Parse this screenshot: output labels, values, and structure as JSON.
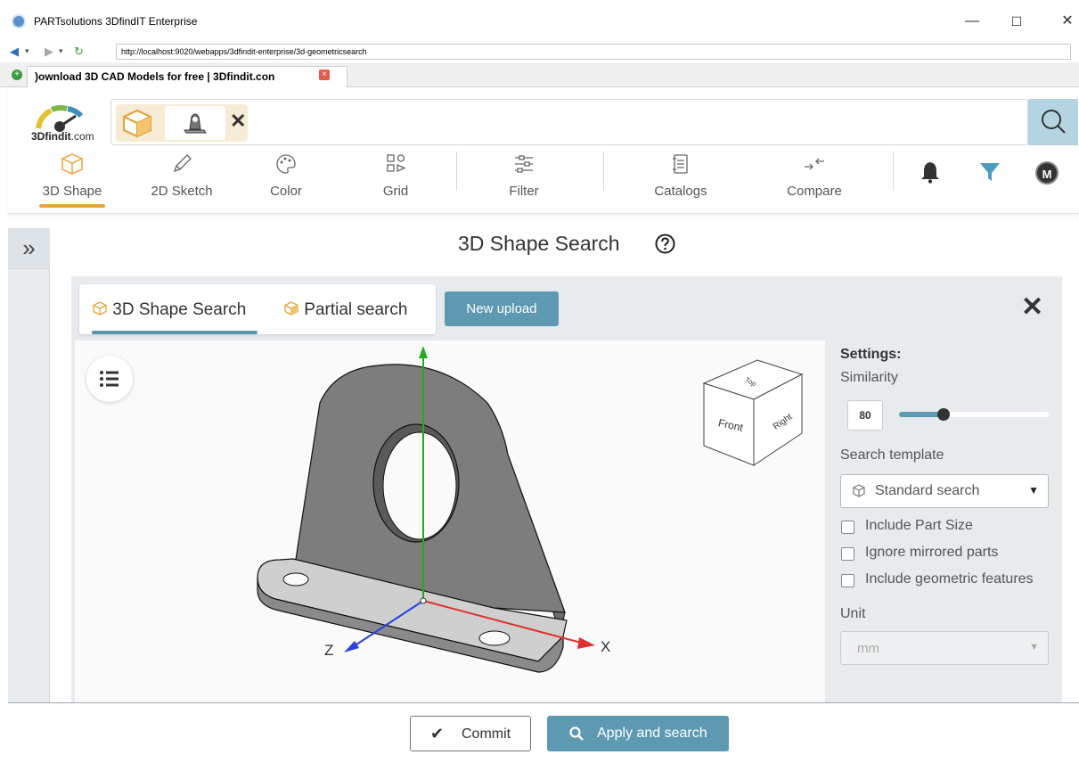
{
  "window": {
    "title": "PARTsolutions 3DfindIT Enterprise",
    "minimize": "—",
    "maximize": "☐",
    "close": "✕"
  },
  "browser": {
    "url": "http://localhost:9020/webapps/3dfindit-enterprise/3d-geometricsearch",
    "tab_title": ")ownload 3D CAD Models for free | 3Dfindit.con"
  },
  "header": {
    "logo_brand": "3Dfindit",
    "logo_suffix": ".com",
    "nav": [
      {
        "label": "3D Shape",
        "icon": "cube-icon",
        "active": true
      },
      {
        "label": "2D Sketch",
        "icon": "pencil-icon"
      },
      {
        "label": "Color",
        "icon": "palette-icon"
      },
      {
        "label": "Grid",
        "icon": "grid-icon"
      },
      {
        "label": "Filter",
        "icon": "sliders-icon"
      },
      {
        "label": "Catalogs",
        "icon": "catalog-icon"
      },
      {
        "label": "Compare",
        "icon": "compare-icon"
      }
    ],
    "avatar": "M",
    "colors": {
      "accent": "#e8a33a",
      "filter": "#4a9bc0",
      "primary": "#5d99b1"
    }
  },
  "page": {
    "title": "3D Shape Search"
  },
  "panel": {
    "tabs": [
      {
        "label": "3D Shape Search",
        "active": true
      },
      {
        "label": "Partial search"
      }
    ],
    "upload_label": "New upload",
    "viewer": {
      "axis_x": "X",
      "axis_z": "Z",
      "cube_top": "Top",
      "cube_front": "Front",
      "cube_right": "Right"
    },
    "settings": {
      "heading": "Settings:",
      "similarity_label": "Similarity",
      "similarity_value": "80",
      "similarity_fraction": 0.3,
      "template_label": "Search template",
      "template_value": "Standard search",
      "options": [
        {
          "label": "Include Part Size",
          "checked": false
        },
        {
          "label": "Ignore mirrored parts",
          "checked": false
        },
        {
          "label": "Include geometric features",
          "checked": false
        }
      ],
      "unit_label": "Unit",
      "unit_value": "mm"
    }
  },
  "footer": {
    "commit_label": "Commit",
    "apply_label": "Apply and search"
  }
}
